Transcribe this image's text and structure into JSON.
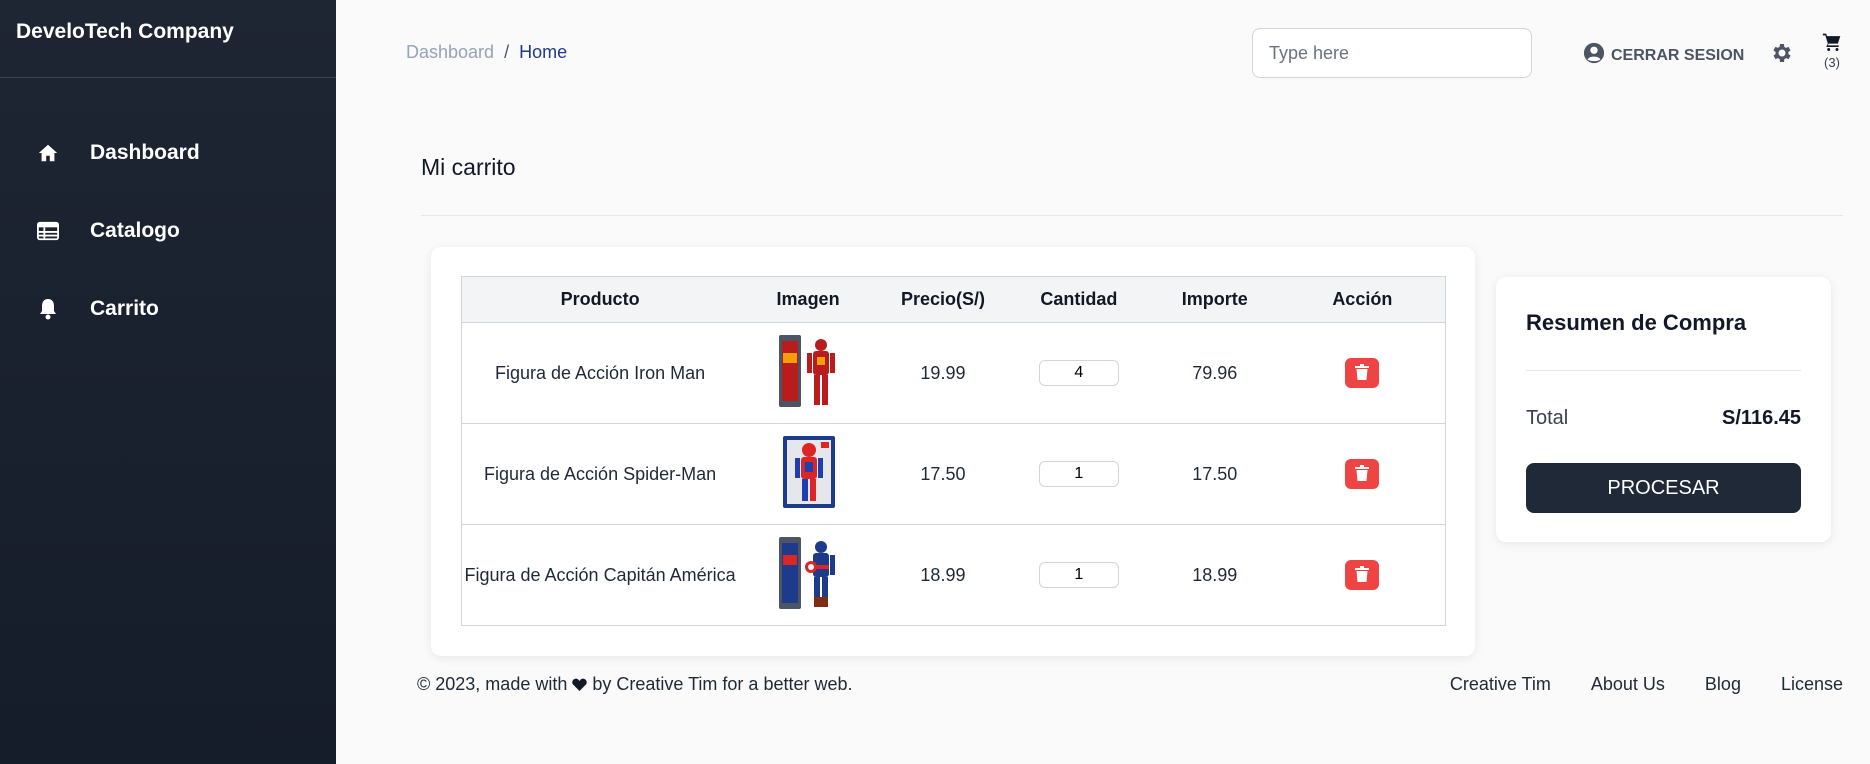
{
  "sidebar": {
    "brand": "DeveloTech Company",
    "items": [
      {
        "label": "Dashboard",
        "icon": "home-icon"
      },
      {
        "label": "Catalogo",
        "icon": "table-icon"
      },
      {
        "label": "Carrito",
        "icon": "bell-icon"
      }
    ]
  },
  "header": {
    "breadcrumb": [
      "Dashboard",
      "/",
      "Home"
    ],
    "search_placeholder": "Type here",
    "logout_label": "CERRAR SESION",
    "cart_count": "(3)"
  },
  "main": {
    "title": "Mi carrito",
    "table": {
      "columns": [
        "Producto",
        "Imagen",
        "Precio(S/)",
        "Cantidad",
        "Importe",
        "Acción"
      ],
      "rows": [
        {
          "product": "Figura de Acción Iron Man",
          "price": "19.99",
          "qty": "4",
          "subtotal": "79.96"
        },
        {
          "product": "Figura de Acción Spider-Man",
          "price": "17.50",
          "qty": "1",
          "subtotal": "17.50"
        },
        {
          "product": "Figura de Acción Capitán América",
          "price": "18.99",
          "qty": "1",
          "subtotal": "18.99"
        }
      ]
    },
    "summary": {
      "title": "Resumen de Compra",
      "total_label": "Total",
      "total_value": "S/116.45",
      "process_label": "PROCESAR"
    }
  },
  "footer": {
    "prefix": "© 2023, made with",
    "suffix": "by Creative Tim for a better web.",
    "links": [
      "Creative Tim",
      "About Us",
      "Blog",
      "License"
    ]
  },
  "colors": {
    "sidebar_bg": "#1e2533",
    "danger": "#ef4444",
    "primary_dark": "#1f2937"
  }
}
